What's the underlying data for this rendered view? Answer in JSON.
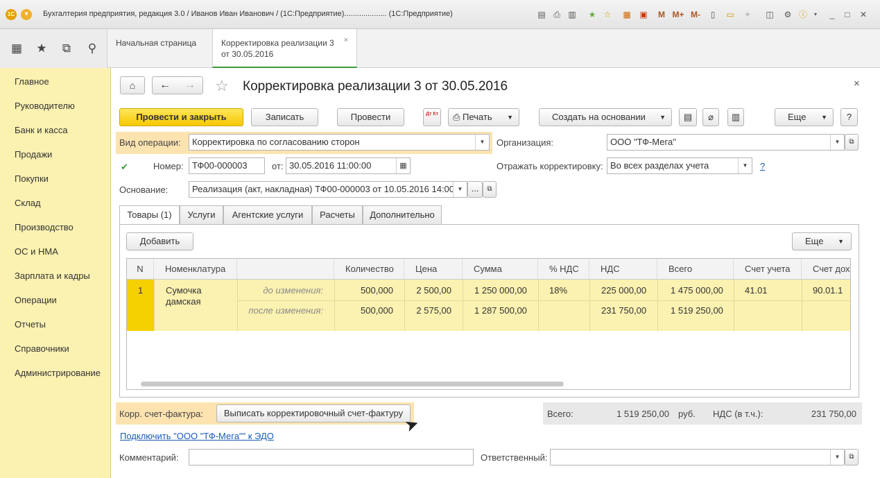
{
  "window": {
    "title": "Бухгалтерия предприятия, редакция 3.0 / Иванов Иван Иванович / (1С:Предприятие).................... (1С:Предприятие)",
    "logo": "1С"
  },
  "tabs": [
    {
      "label": "Начальная страница"
    },
    {
      "label": "Корректировка реализации 3 от 30.05.2016",
      "close": "×"
    }
  ],
  "sidebar": {
    "items": [
      "Главное",
      "Руководителю",
      "Банк и касса",
      "Продажи",
      "Покупки",
      "Склад",
      "Производство",
      "ОС и НМА",
      "Зарплата и кадры",
      "Операции",
      "Отчеты",
      "Справочники",
      "Администрирование"
    ]
  },
  "doc": {
    "title": "Корректировка реализации 3 от 30.05.2016",
    "close": "×"
  },
  "toolbar": {
    "post_close": "Провести и закрыть",
    "save": "Записать",
    "post": "Провести",
    "print": "Печать",
    "create_based": "Создать на основании",
    "more": "Еще",
    "help": "?",
    "dtkt": "Дт Кт"
  },
  "fields": {
    "op_label": "Вид операции:",
    "op_value": "Корректировка по согласованию сторон",
    "org_label": "Организация:",
    "org_value": "ООО \"ТФ-Мега\"",
    "num_label": "Номер:",
    "num_value": "ТФ00-000003",
    "from_label": "от:",
    "date_value": "30.05.2016 11:00:00",
    "reflect_label": "Отражать корректировку:",
    "reflect_value": "Во всех разделах учета",
    "reflect_help": "?",
    "basis_label": "Основание:",
    "basis_value": "Реализация (акт, накладная) ТФ00-000003 от 10.05.2016 14:00:",
    "basis_more": "..."
  },
  "subtabs": [
    "Товары (1)",
    "Услуги",
    "Агентские услуги",
    "Расчеты",
    "Дополнительно"
  ],
  "table_toolbar": {
    "add": "Добавить",
    "more": "Еще"
  },
  "table": {
    "headers": [
      "N",
      "Номенклатура",
      "",
      "Количество",
      "Цена",
      "Сумма",
      "% НДС",
      "НДС",
      "Всего",
      "Счет учета",
      "Счет дох"
    ],
    "row": {
      "n": "1",
      "name_line1": "Сумочка",
      "name_line2": "дамская",
      "before_label": "до изменения:",
      "after_label": "после изменения:",
      "before": {
        "qty": "500,000",
        "price": "2 500,00",
        "sum": "1 250 000,00",
        "vat_rate": "18%",
        "vat": "225 000,00",
        "total": "1 475 000,00",
        "account": "41.01",
        "income": "90.01.1"
      },
      "after": {
        "qty": "500,000",
        "price": "2 575,00",
        "sum": "1 287 500,00",
        "vat": "231 750,00",
        "total": "1 519 250,00"
      }
    }
  },
  "footer": {
    "invoice_label": "Корр. счет-фактура:",
    "invoice_button": "Выписать корректировочный счет-фактуру",
    "total_label": "Всего:",
    "total_value": "1 519 250,00",
    "currency": "руб.",
    "vat_label": "НДС (в т.ч.):",
    "vat_value": "231 750,00",
    "edo_link": "Подключить \"ООО \"ТФ-Мега\"\" к ЭДО",
    "comment_label": "Комментарий:",
    "responsible_label": "Ответственный:"
  },
  "colors": {
    "accent_yellow": "#f5c800",
    "sidebar": "#fbf1b0",
    "highlight": "#fce3b0",
    "link": "#1a5ab8"
  }
}
